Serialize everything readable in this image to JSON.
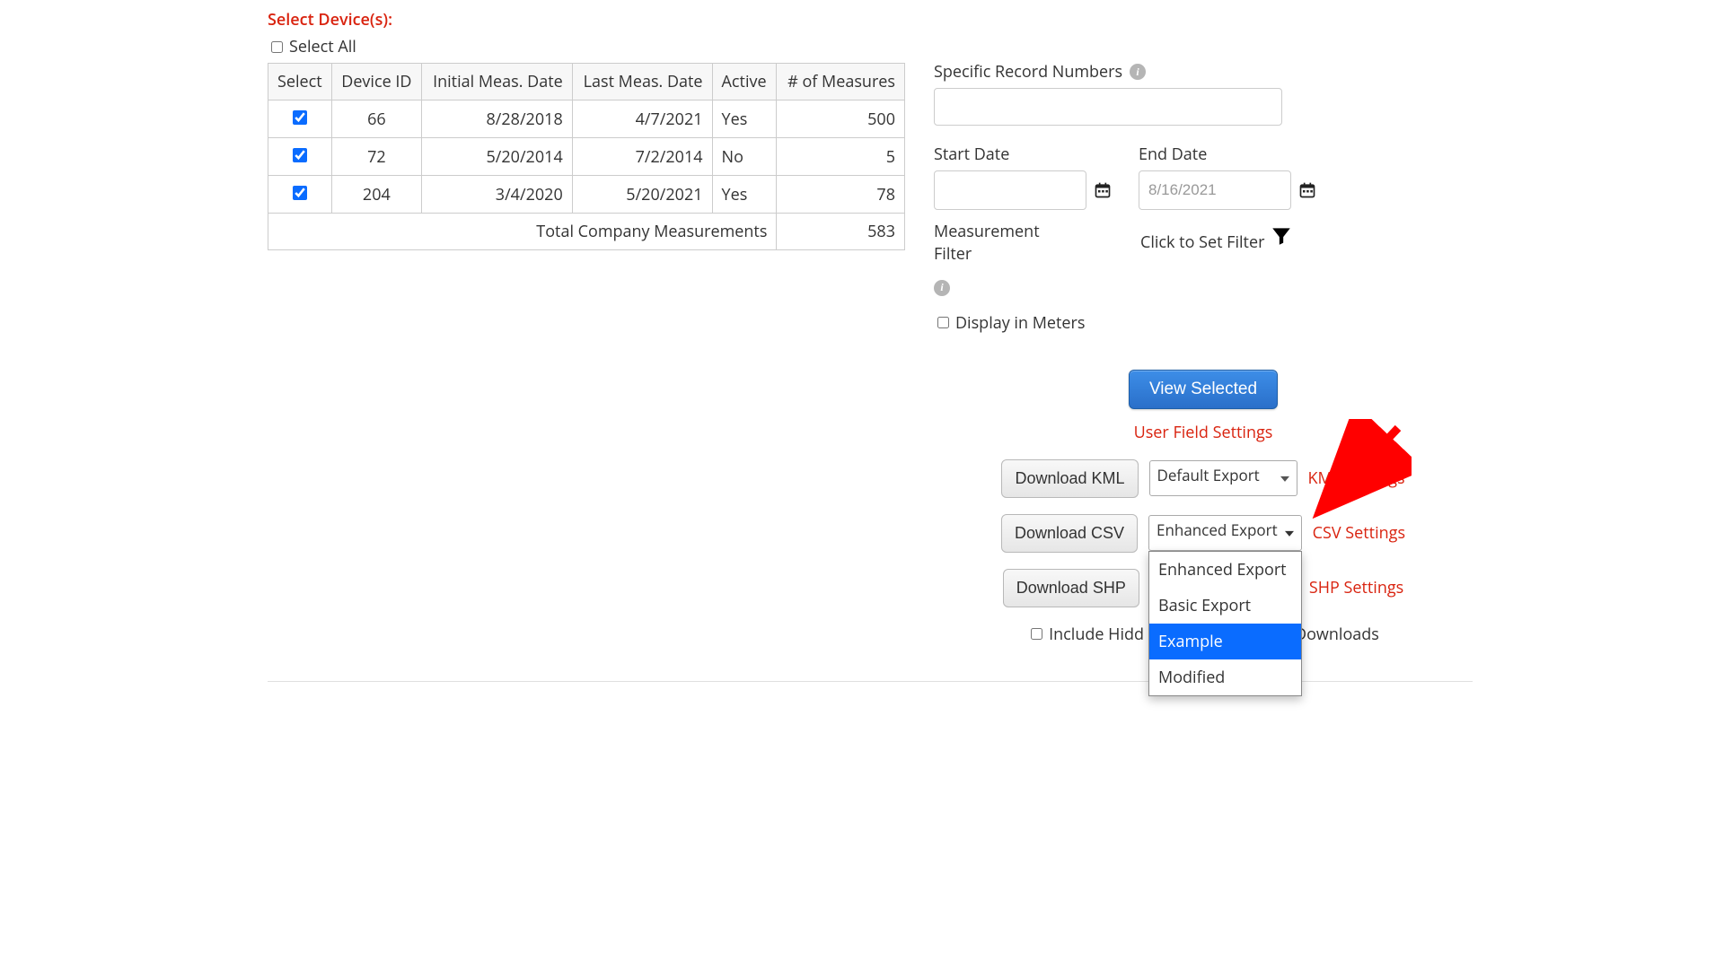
{
  "header": {
    "select_devices": "Select Device(s):",
    "select_all": "Select All"
  },
  "table": {
    "headers": {
      "select": "Select",
      "device_id": "Device ID",
      "initial_date": "Initial Meas. Date",
      "last_date": "Last Meas. Date",
      "active": "Active",
      "measures": "# of Measures"
    },
    "rows": [
      {
        "device_id": "66",
        "initial": "8/28/2018",
        "last": "4/7/2021",
        "active": "Yes",
        "measures": "500"
      },
      {
        "device_id": "72",
        "initial": "5/20/2014",
        "last": "7/2/2014",
        "active": "No",
        "measures": "5"
      },
      {
        "device_id": "204",
        "initial": "3/4/2020",
        "last": "5/20/2021",
        "active": "Yes",
        "measures": "78"
      }
    ],
    "footer_label": "Total Company Measurements",
    "footer_value": "583"
  },
  "filters": {
    "specific_record_label": "Specific Record Numbers",
    "start_date_label": "Start Date",
    "end_date_label": "End Date",
    "end_date_placeholder": "8/16/2021",
    "meas_filter_label_1": "Measurement",
    "meas_filter_label_2": "Filter",
    "click_set_filter": "Click to Set Filter",
    "display_meters": "Display in Meters"
  },
  "actions": {
    "view_selected": "View Selected",
    "user_field_settings": "User Field Settings",
    "download_kml": "Download KML",
    "kml_select": "Default Export",
    "kml_settings": "KML Settings",
    "download_csv": "Download CSV",
    "csv_select": "Enhanced Export",
    "csv_settings": "CSV Settings",
    "download_shp": "Download SHP",
    "shp_settings": "SHP Settings",
    "include_hidden_pre": "Include Hidd",
    "include_hidden_post": "Downloads",
    "csv_options": {
      "o0": "Enhanced Export",
      "o1": "Basic Export",
      "o2": "Example",
      "o3": "Modified"
    }
  }
}
